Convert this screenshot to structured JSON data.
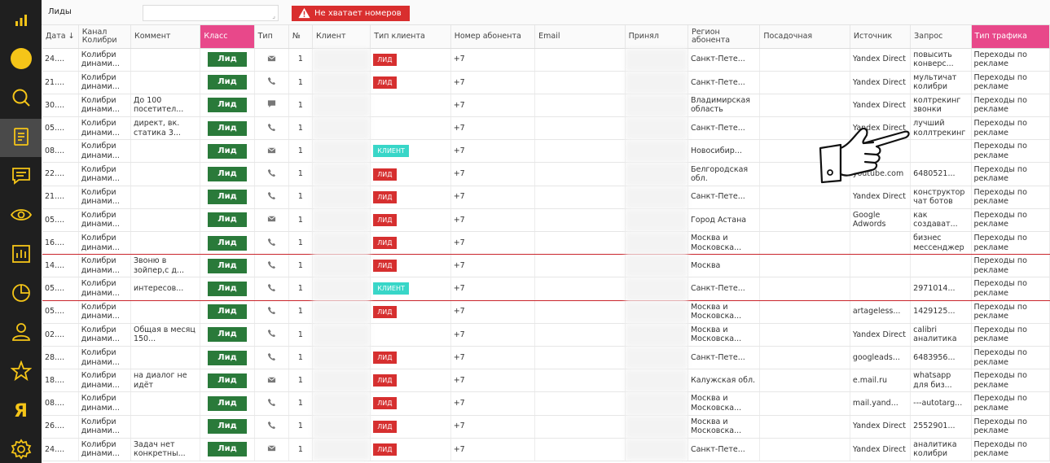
{
  "sidebar": [
    {
      "icon": "stats-logo-icon",
      "active": false
    },
    {
      "icon": "yellow-circle-icon",
      "active": false
    },
    {
      "icon": "search-icon",
      "active": false
    },
    {
      "icon": "document-icon",
      "active": true
    },
    {
      "icon": "chat-icon",
      "active": false
    },
    {
      "icon": "eye-icon",
      "active": false
    },
    {
      "icon": "bar-chart-icon",
      "active": false
    },
    {
      "icon": "pie-chart-icon",
      "active": false
    },
    {
      "icon": "user-icon",
      "active": false
    },
    {
      "icon": "star-icon",
      "active": false
    },
    {
      "icon": "yandex-icon",
      "active": false,
      "text": "Я"
    },
    {
      "icon": "gear-icon",
      "active": false
    }
  ],
  "header": {
    "title": "Лиды",
    "search_value": "",
    "alert": "Не хватает номеров"
  },
  "columns": [
    "Дата ↓",
    "Канал Колибри",
    "Коммент",
    "Класс",
    "Тип",
    "№",
    "Клиент",
    "Тип клиента",
    "Номер абонента",
    "Email",
    "Принял",
    "Регион абонента",
    "Посадочная",
    "Источник",
    "Запрос",
    "Тип трафика"
  ],
  "pink_columns": [
    3,
    15
  ],
  "colors": {
    "sidebar": "#1f1f1f",
    "pink": "#e8488a",
    "green": "#2a7a3a",
    "red": "#d62f2f",
    "teal": "#38d6c8",
    "highlight": "#c9252c"
  },
  "rows": [
    {
      "date": "24....",
      "channel": "Колибри динами...",
      "comment": "",
      "class": "Лид",
      "type": "mail",
      "num": "1",
      "client_type": "ЛИД",
      "phone": "+7",
      "region": "Санкт-Пете...",
      "source": "Yandex Direct",
      "source_grey": false,
      "query": "повысить конверс...",
      "traffic": "Переходы по рекламе",
      "hl": false
    },
    {
      "date": "21....",
      "channel": "Колибри динами...",
      "comment": "",
      "class": "Лид",
      "type": "phone",
      "num": "1",
      "client_type": "ЛИД",
      "phone": "+7",
      "region": "Санкт-Пете...",
      "source": "Yandex Direct",
      "source_grey": false,
      "query": "мультичат колибри",
      "traffic": "Переходы по рекламе",
      "hl": false
    },
    {
      "date": "30....",
      "channel": "Колибри динами...",
      "comment": "До 100 посетител...",
      "class": "Лид",
      "type": "chat",
      "num": "1",
      "client_type": "",
      "phone": "+7",
      "region": "Владимирская область",
      "source": "Yandex Direct",
      "source_grey": false,
      "query": "колтрекинг звонки",
      "traffic": "Переходы по рекламе",
      "hl": false
    },
    {
      "date": "05....",
      "channel": "Колибри динами...",
      "comment": "директ, вк. статика 3...",
      "class": "Лид",
      "type": "phone",
      "num": "1",
      "client_type": "",
      "phone": "+7",
      "region": "Санкт-Пете...",
      "source": "Yandex Direct",
      "source_grey": false,
      "query": "лучший коллтрекинг",
      "traffic": "Переходы по рекламе",
      "hl": false
    },
    {
      "date": "08....",
      "channel": "Колибри динами...",
      "comment": "",
      "class": "Лид",
      "type": "mail",
      "num": "1",
      "client_type": "КЛИЕНТ",
      "phone": "+7",
      "region": "Новосибир...",
      "source": "",
      "source_grey": false,
      "query": "",
      "traffic": "Переходы по рекламе",
      "hl": false
    },
    {
      "date": "22....",
      "channel": "Колибри динами...",
      "comment": "",
      "class": "Лид",
      "type": "phone",
      "num": "1",
      "client_type": "ЛИД",
      "phone": "+7",
      "region": "Белгородская обл.",
      "source": "youtube.com",
      "source_grey": true,
      "query": "6480521...",
      "traffic": "Переходы по рекламе",
      "hl": false
    },
    {
      "date": "21....",
      "channel": "Колибри динами...",
      "comment": "",
      "class": "Лид",
      "type": "phone",
      "num": "1",
      "client_type": "ЛИД",
      "phone": "+7",
      "region": "Санкт-Пете...",
      "source": "Yandex Direct",
      "source_grey": false,
      "query": "конструктор чат ботов",
      "traffic": "Переходы по рекламе",
      "hl": false
    },
    {
      "date": "05....",
      "channel": "Колибри динами...",
      "comment": "",
      "class": "Лид",
      "type": "mail",
      "num": "1",
      "client_type": "ЛИД",
      "phone": "+7",
      "region": "Город Астана",
      "source": "Google Adwords",
      "source_grey": false,
      "query": "как создават...",
      "traffic": "Переходы по рекламе",
      "hl": false
    },
    {
      "date": "16....",
      "channel": "Колибри динами...",
      "comment": "",
      "class": "Лид",
      "type": "phone",
      "num": "1",
      "client_type": "ЛИД",
      "phone": "+7",
      "region": "Москва и Московска...",
      "source": "",
      "source_grey": false,
      "query": "бизнес мессенджер",
      "traffic": "Переходы по рекламе",
      "hl": true
    },
    {
      "date": "14....",
      "channel": "Колибри динами...",
      "comment": "Звоню в зойпер,с д...",
      "class": "Лид",
      "type": "phone",
      "num": "1",
      "client_type": "ЛИД",
      "phone": "+7",
      "region": "Москва",
      "source": "",
      "source_grey": false,
      "query": "",
      "traffic": "Переходы по рекламе",
      "hl": false
    },
    {
      "date": "05....",
      "channel": "Колибри динами...",
      "comment": "интересов...",
      "class": "Лид",
      "type": "phone",
      "num": "1",
      "client_type": "КЛИЕНТ",
      "phone": "+7",
      "region": "Санкт-Пете...",
      "source": "",
      "source_grey": false,
      "query": "2971014...",
      "traffic": "Переходы по рекламе",
      "hl": true
    },
    {
      "date": "05....",
      "channel": "Колибри динами...",
      "comment": "",
      "class": "Лид",
      "type": "phone",
      "num": "1",
      "client_type": "ЛИД",
      "phone": "+7",
      "region": "Москва и Московска...",
      "source": "artageless...",
      "source_grey": true,
      "query": "1429125...",
      "traffic": "Переходы по рекламе",
      "hl": false
    },
    {
      "date": "02....",
      "channel": "Колибри динами...",
      "comment": "Общая в месяц 150...",
      "class": "Лид",
      "type": "phone",
      "num": "1",
      "client_type": "",
      "phone": "+7",
      "region": "Москва и Московска...",
      "source": "Yandex Direct",
      "source_grey": false,
      "query": "calibri аналитика",
      "traffic": "Переходы по рекламе",
      "hl": false
    },
    {
      "date": "28....",
      "channel": "Колибри динами...",
      "comment": "",
      "class": "Лид",
      "type": "phone",
      "num": "1",
      "client_type": "ЛИД",
      "phone": "+7",
      "region": "Санкт-Пете...",
      "source": "googleads...",
      "source_grey": true,
      "query": "6483956...",
      "traffic": "Переходы по рекламе",
      "hl": false
    },
    {
      "date": "18....",
      "channel": "Колибри динами...",
      "comment": "на диалог не идёт",
      "class": "Лид",
      "type": "mail",
      "num": "1",
      "client_type": "ЛИД",
      "phone": "+7",
      "region": "Калужская обл.",
      "source": "e.mail.ru",
      "source_grey": true,
      "query": "whatsapp для биз...",
      "traffic": "Переходы по рекламе",
      "hl": false
    },
    {
      "date": "08....",
      "channel": "Колибри динами...",
      "comment": "",
      "class": "Лид",
      "type": "phone",
      "num": "1",
      "client_type": "ЛИД",
      "phone": "+7",
      "region": "Москва и Московска...",
      "source": "mail.yand...",
      "source_grey": true,
      "query": "---autotarg...",
      "traffic": "Переходы по рекламе",
      "hl": false
    },
    {
      "date": "26....",
      "channel": "Колибри динами...",
      "comment": "",
      "class": "Лид",
      "type": "phone",
      "num": "1",
      "client_type": "ЛИД",
      "phone": "+7",
      "region": "Москва и Московска...",
      "source": "Yandex Direct",
      "source_grey": false,
      "query": "2552901...",
      "traffic": "Переходы по рекламе",
      "hl": false
    },
    {
      "date": "24....",
      "channel": "Колибри динами...",
      "comment": "Задач нет конкретны...",
      "class": "Лид",
      "type": "mail",
      "num": "1",
      "client_type": "ЛИД",
      "phone": "+7",
      "region": "Санкт-Пете...",
      "source": "Yandex Direct",
      "source_grey": false,
      "query": "аналитика колибри",
      "traffic": "Переходы по рекламе",
      "hl": false
    }
  ]
}
